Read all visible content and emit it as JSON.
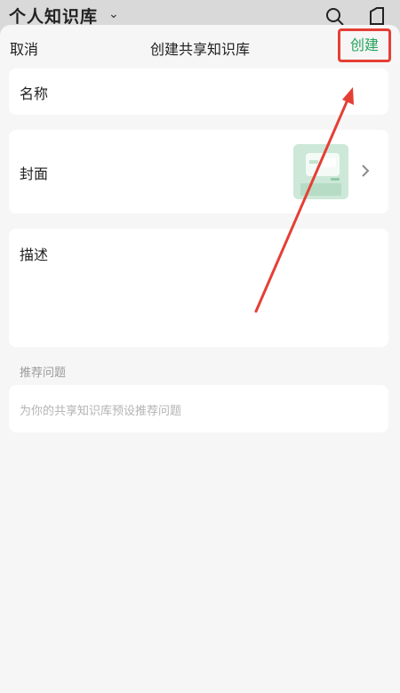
{
  "background": {
    "title": "个人知识库"
  },
  "sheet": {
    "cancel_label": "取消",
    "title": "创建共享知识库",
    "create_label": "创建"
  },
  "form": {
    "name_label": "名称",
    "cover_label": "封面",
    "description_label": "描述",
    "recommended_label": "推荐问题",
    "recommended_placeholder": "为你的共享知识库预设推荐问题"
  },
  "colors": {
    "accent_green": "#23a35a",
    "annotation_red": "#e53f35"
  }
}
